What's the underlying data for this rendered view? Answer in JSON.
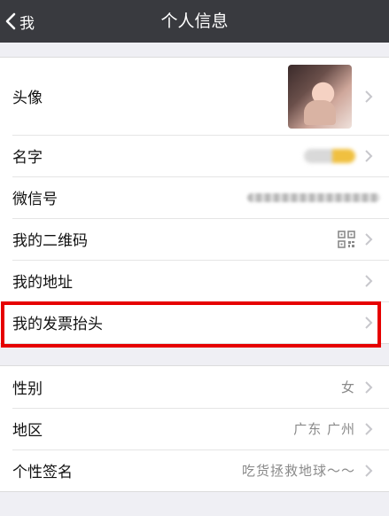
{
  "nav": {
    "back_label": "我",
    "title": "个人信息"
  },
  "profile": {
    "avatar_label": "头像",
    "name_label": "名字",
    "wechat_id_label": "微信号",
    "qrcode_label": "我的二维码",
    "address_label": "我的地址",
    "invoice_label": "我的发票抬头"
  },
  "details": {
    "gender_label": "性别",
    "gender_value": "女",
    "region_label": "地区",
    "region_value": "广东 广州",
    "signature_label": "个性签名",
    "signature_value": "吃货拯救地球～～"
  },
  "icons": {
    "back": "chevron-left-icon",
    "disclosure": "chevron-right-icon",
    "qrcode": "qrcode-icon"
  },
  "colors": {
    "navbar": "#393a3f",
    "background": "#efeff4",
    "highlight": "#e60000"
  }
}
